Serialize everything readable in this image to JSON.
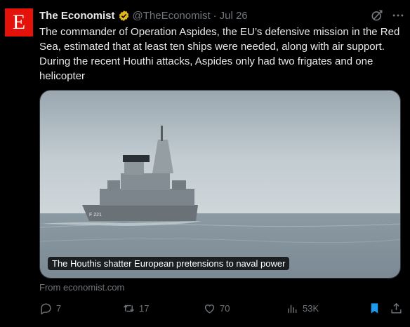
{
  "author": {
    "avatar_letter": "E",
    "name": "The Economist",
    "handle": "@TheEconomist",
    "separator": "·",
    "date": "Jul 26"
  },
  "tweet_text": "The commander of Operation Aspides, the EU’s defensive mission in the Red Sea, estimated that at least ten ships were needed, along with air support. During the recent Houthi attacks, Aspides only had two frigates and one helicopter",
  "card": {
    "caption": "The Houthis shatter European pretensions to naval power",
    "hull_number": "F 221",
    "source": "From economist.com"
  },
  "actions": {
    "replies": "7",
    "reposts": "17",
    "likes": "70",
    "views": "53K"
  },
  "colors": {
    "background": "#000000",
    "brand_red": "#e3120b",
    "text_primary": "#e7e9ea",
    "text_secondary": "#71767b",
    "verified_gold": "#e2b719",
    "bookmark_active": "#1d9bf0"
  },
  "icons": [
    "verified-gold-badge-icon",
    "grok-icon",
    "more-icon",
    "reply-icon",
    "repost-icon",
    "like-icon",
    "views-icon",
    "bookmark-icon",
    "share-icon"
  ]
}
